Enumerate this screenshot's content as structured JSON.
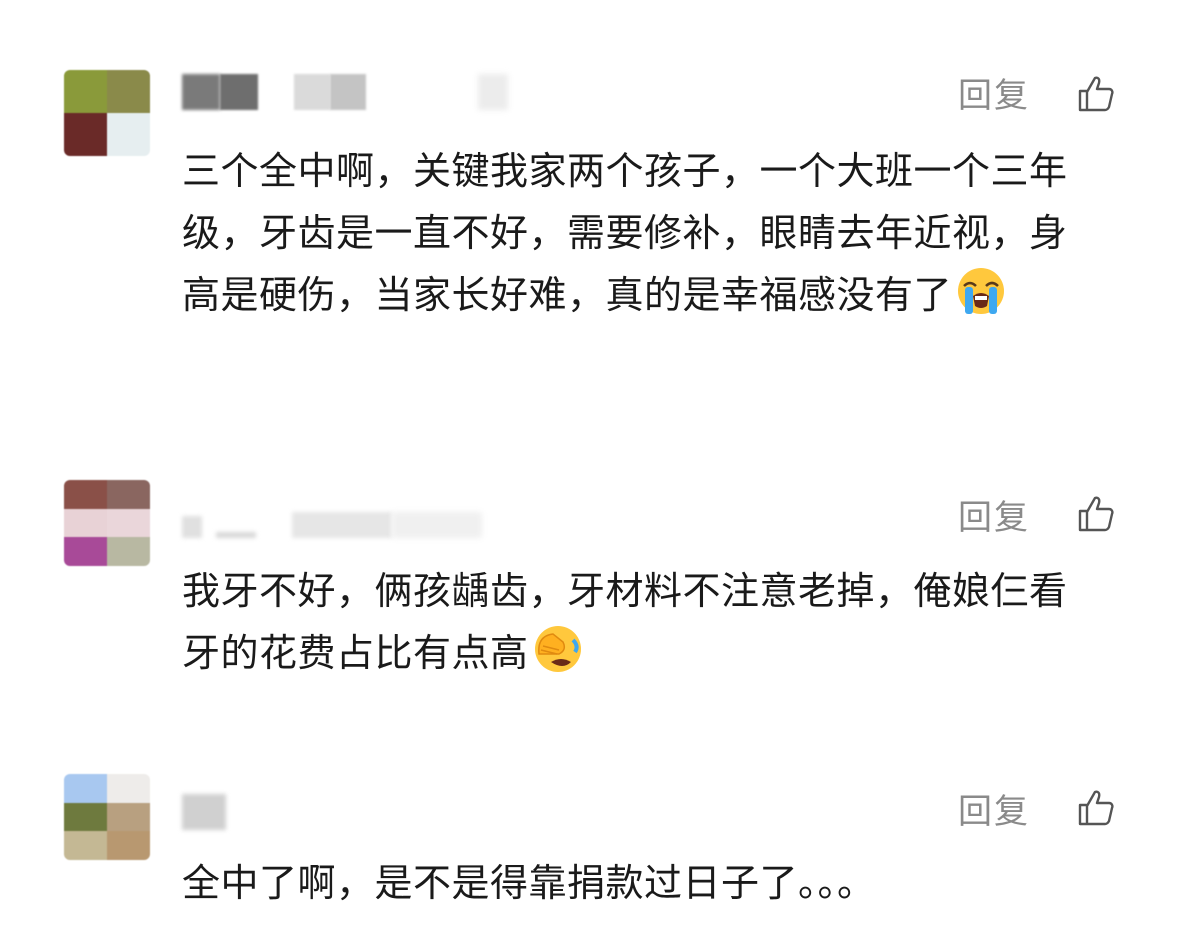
{
  "comments": [
    {
      "reply_label": "回复",
      "text": "三个全中啊，关键我家两个孩子，一个大班一个三年级，牙齿是一直不好，需要修补，眼睛去年近视，身高是硬伤，当家长好难，真的是幸福感没有了",
      "emoji": "loudly-crying-face-emoji",
      "avatar_colors": [
        "#8a9a3a",
        "#8a8a4a",
        "#6a2a28",
        "#e6eef0"
      ]
    },
    {
      "reply_label": "回复",
      "text": "我牙不好，俩孩龋齿，牙材料不注意老掉，俺娘仨看牙的花费占比有点高",
      "emoji": "face-palm-crying-emoji",
      "avatar_colors": [
        "#8a5048",
        "#8a6660",
        "#e8d2d6",
        "#ead6da",
        "#a84a98",
        "#b8b8a2"
      ]
    },
    {
      "reply_label": "回复",
      "text": "全中了啊，是不是得靠捐款过日子了。。。",
      "emoji": "",
      "avatar_colors": [
        "#a8c8f0",
        "#eeecea",
        "#6e7a3e",
        "#b8a080",
        "#c4b894",
        "#b89870"
      ]
    }
  ],
  "icons": {
    "like": "thumbs-up-icon"
  },
  "colors": {
    "text": "#1a1a1a",
    "secondary": "#8a8a8a"
  }
}
